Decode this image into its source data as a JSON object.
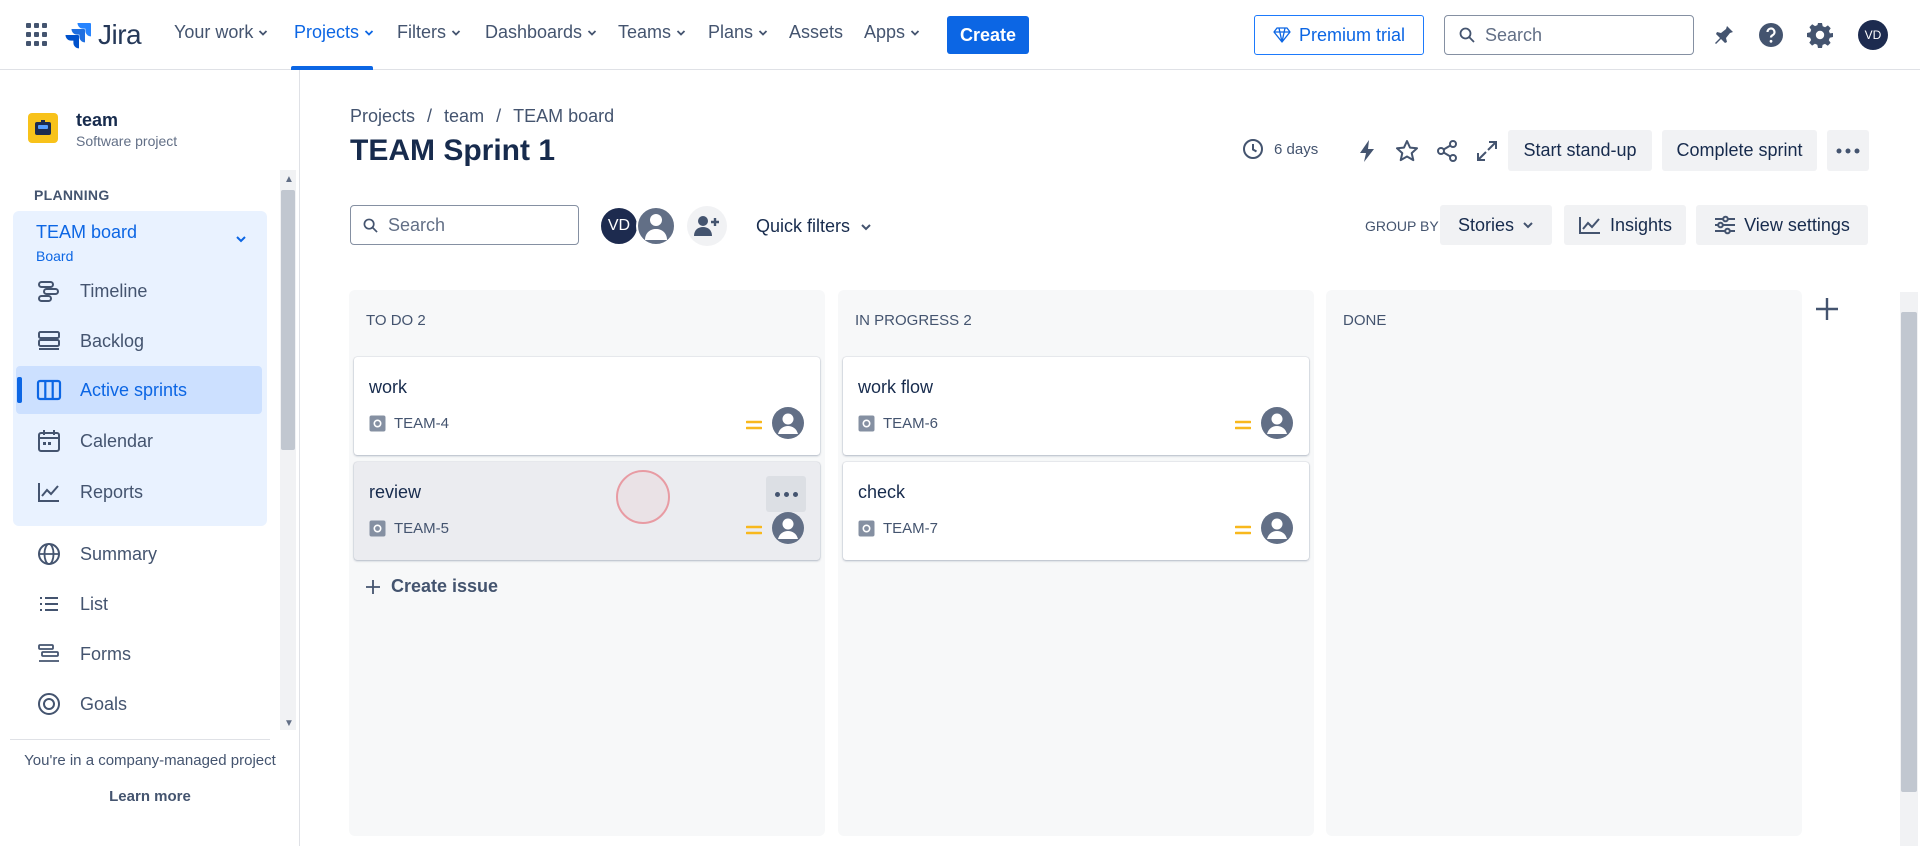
{
  "topnav": {
    "logo_text": "Jira",
    "items": [
      {
        "label": "Your work"
      },
      {
        "label": "Projects"
      },
      {
        "label": "Filters"
      },
      {
        "label": "Dashboards"
      },
      {
        "label": "Teams"
      },
      {
        "label": "Plans"
      },
      {
        "label": "Assets"
      },
      {
        "label": "Apps"
      }
    ],
    "create_label": "Create",
    "premium_label": "Premium trial",
    "search_placeholder": "Search",
    "user_initials": "VD",
    "accent_color": "#0c66e4"
  },
  "sidebar": {
    "project_name": "team",
    "project_type": "Software project",
    "section_label": "PLANNING",
    "board_title": "TEAM board",
    "board_subtitle": "Board",
    "planning_items": [
      {
        "label": "Timeline",
        "icon": "timeline-icon"
      },
      {
        "label": "Backlog",
        "icon": "backlog-icon"
      },
      {
        "label": "Active sprints",
        "icon": "board-columns-icon"
      },
      {
        "label": "Calendar",
        "icon": "calendar-icon"
      },
      {
        "label": "Reports",
        "icon": "chart-line-icon"
      }
    ],
    "other_items": [
      {
        "label": "Summary",
        "icon": "globe-icon"
      },
      {
        "label": "List",
        "icon": "list-icon"
      },
      {
        "label": "Forms",
        "icon": "forms-icon"
      },
      {
        "label": "Goals",
        "icon": "goal-icon"
      }
    ],
    "footer_note": "You're in a company-managed project",
    "footer_link": "Learn more"
  },
  "header": {
    "breadcrumb": [
      "Projects",
      "/",
      "team",
      "/",
      "TEAM board"
    ],
    "title": "TEAM Sprint 1",
    "time_remaining": "6 days",
    "start_standup": "Start stand-up",
    "complete_sprint": "Complete sprint"
  },
  "toolbar": {
    "search_placeholder": "Search",
    "avatar_initials": "VD",
    "quick_filters": "Quick filters",
    "group_by_label": "GROUP BY",
    "group_by_value": "Stories",
    "insights": "Insights",
    "view_settings": "View settings"
  },
  "board": {
    "columns": [
      {
        "title": "TO DO 2",
        "cards": [
          {
            "summary": "work",
            "key": "TEAM-4"
          },
          {
            "summary": "review",
            "key": "TEAM-5"
          }
        ],
        "create_label": "Create issue"
      },
      {
        "title": "IN PROGRESS 2",
        "cards": [
          {
            "summary": "work flow",
            "key": "TEAM-6"
          },
          {
            "summary": "check",
            "key": "TEAM-7"
          }
        ]
      },
      {
        "title": "DONE",
        "cards": []
      }
    ],
    "priority_color": "#f8b81d"
  }
}
